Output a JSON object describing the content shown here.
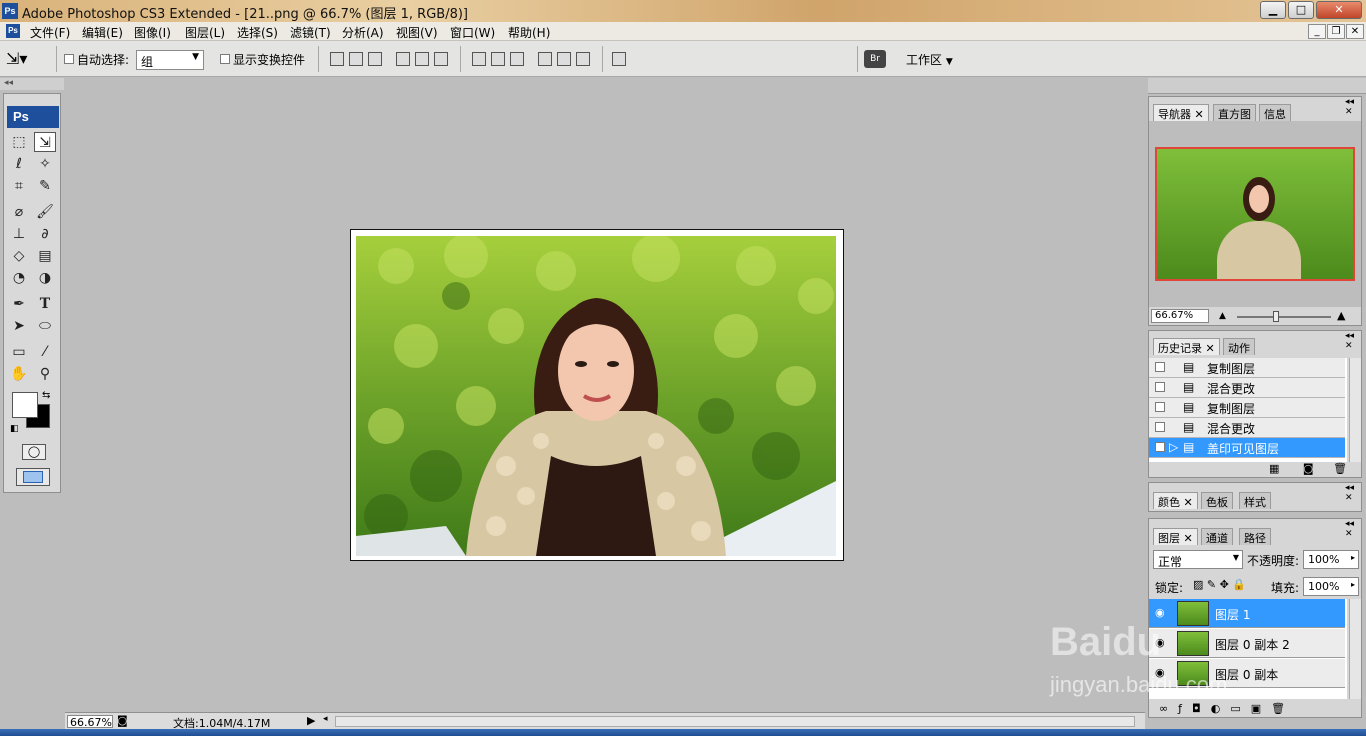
{
  "window": {
    "title": "Adobe Photoshop CS3 Extended - [21..png @ 66.7% (图层 1, RGB/8)]",
    "app_icon": "Ps"
  },
  "menu": [
    "文件(F)",
    "编辑(E)",
    "图像(I)",
    "图层(L)",
    "选择(S)",
    "滤镜(T)",
    "分析(A)",
    "视图(V)",
    "窗口(W)",
    "帮助(H)"
  ],
  "options": {
    "auto_select_label": "自动选择:",
    "auto_select_value": "组",
    "show_transform_label": "显示变换控件",
    "workspace_label": "工作区"
  },
  "toolbox": {
    "logo": "Ps"
  },
  "navigator": {
    "tabs": [
      "导航器",
      "直方图",
      "信息"
    ],
    "zoom": "66.67%"
  },
  "history": {
    "tabs": [
      "历史记录",
      "动作"
    ],
    "items": [
      "复制图层",
      "混合更改",
      "复制图层",
      "混合更改",
      "盖印可见图层"
    ],
    "selected_index": 4
  },
  "color_panel": {
    "tabs": [
      "颜色",
      "色板",
      "样式"
    ]
  },
  "layers": {
    "tabs": [
      "图层",
      "通道",
      "路径"
    ],
    "blend_mode": "正常",
    "opacity_label": "不透明度:",
    "opacity": "100%",
    "lock_label": "锁定:",
    "fill_label": "填充:",
    "fill": "100%",
    "items": [
      "图层 1",
      "图层 0 副本 2",
      "图层 0 副本"
    ],
    "selected_index": 0
  },
  "status": {
    "zoom": "66.67%",
    "doc": "文档:1.04M/4.17M"
  },
  "watermark": {
    "text": "jingyan.baidu.com",
    "brand": "Baidu"
  },
  "colors": {
    "selection": "#3399ff",
    "panel_bg": "#d6d6d6",
    "workspace": "#bdbdbd"
  }
}
